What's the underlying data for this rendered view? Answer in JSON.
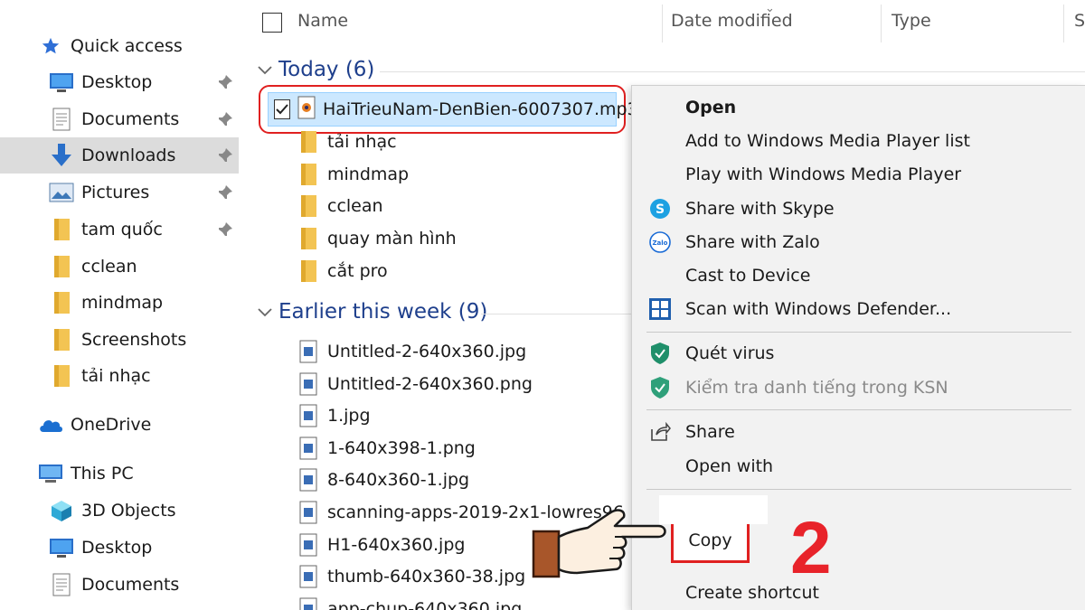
{
  "sidebar": {
    "quick_access": "Quick access",
    "items": [
      {
        "label": "Desktop",
        "icon": "desktop-icon",
        "pinned": true
      },
      {
        "label": "Documents",
        "icon": "documents-icon",
        "pinned": true
      },
      {
        "label": "Downloads",
        "icon": "download-arrow-icon",
        "pinned": true,
        "active": true
      },
      {
        "label": "Pictures",
        "icon": "pictures-icon",
        "pinned": true
      },
      {
        "label": "tam quốc",
        "icon": "folder-icon",
        "pinned": true
      },
      {
        "label": "cclean",
        "icon": "folder-icon"
      },
      {
        "label": "mindmap",
        "icon": "folder-icon"
      },
      {
        "label": "Screenshots",
        "icon": "folder-icon"
      },
      {
        "label": "tải nhạc",
        "icon": "folder-icon"
      }
    ],
    "onedrive": "OneDrive",
    "this_pc": "This PC",
    "pc_items": [
      {
        "label": "3D Objects",
        "icon": "3d-objects-icon"
      },
      {
        "label": "Desktop",
        "icon": "desktop-icon"
      },
      {
        "label": "Documents",
        "icon": "documents-icon"
      }
    ]
  },
  "header": {
    "name": "Name",
    "date_modified": "Date modified",
    "type": "Type",
    "size_partial": "S"
  },
  "groups": {
    "today": {
      "label": "Today (6)",
      "selected_file": "HaiTrieuNam-DenBien-6007307.mp3",
      "files": [
        "tải nhạc",
        "mindmap",
        "cclean",
        "quay màn hình",
        "cắt pro"
      ]
    },
    "earlier": {
      "label": "Earlier this week (9)",
      "files": [
        "Untitled-2-640x360.jpg",
        "Untitled-2-640x360.png",
        "1.jpg",
        "1-640x398-1.png",
        "8-640x360-1.jpg",
        "scanning-apps-2019-2x1-lowres96",
        "H1-640x360.jpg",
        "thumb-640x360-38.jpg",
        "app-chup-640x360.jpg"
      ]
    }
  },
  "context_menu": {
    "open": "Open",
    "add_wmp": "Add to Windows Media Player list",
    "play_wmp": "Play with Windows Media Player",
    "share_skype": "Share with Skype",
    "share_zalo": "Share with Zalo",
    "zalo_badge": "Zalo",
    "cast": "Cast to Device",
    "scan_defender": "Scan with Windows Defender...",
    "quet_virus": "Quét virus",
    "kiem_tra": "Kiểm tra danh tiếng trong KSN",
    "share": "Share",
    "open_with": "Open with",
    "copy": "Copy",
    "create_shortcut": "Create shortcut"
  },
  "annotation": {
    "step": "2"
  },
  "colors": {
    "accent_blue": "#1e3f8c",
    "highlight_red": "#e02020",
    "selection_blue": "#cce8ff",
    "folder_yellow": "#f3c453"
  }
}
